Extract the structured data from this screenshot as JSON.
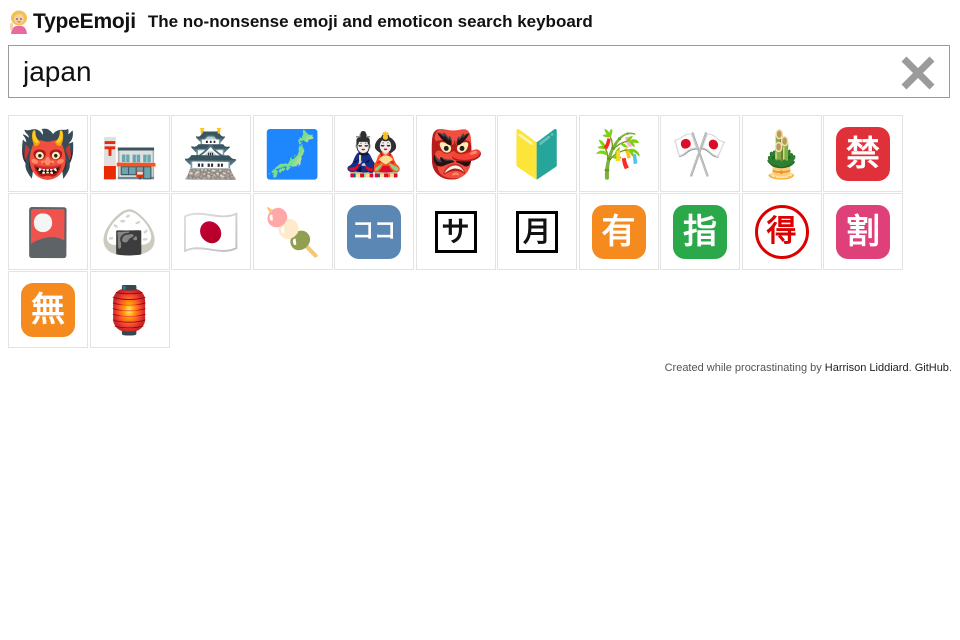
{
  "header": {
    "logo_icon": "person-raising-hand-emoji",
    "brand": "TypeEmoji",
    "tagline": "The no-nonsense emoji and emoticon search keyboard"
  },
  "search": {
    "value": "japan",
    "clear_icon": "close-x-icon"
  },
  "results": [
    {
      "name": "japanese-ogre",
      "glyph": "👹"
    },
    {
      "name": "japanese-post-office",
      "glyph": "🏣"
    },
    {
      "name": "japanese-castle",
      "glyph": "🏯"
    },
    {
      "name": "silhouette-of-japan",
      "glyph": "🗾"
    },
    {
      "name": "japanese-dolls",
      "glyph": "🎎"
    },
    {
      "name": "japanese-goblin",
      "glyph": "👺"
    },
    {
      "name": "japanese-symbol-for-beginner",
      "glyph": "🔰"
    },
    {
      "name": "tanabata-tree",
      "glyph": "🎋"
    },
    {
      "name": "crossed-flags",
      "glyph": "🎌"
    },
    {
      "name": "pine-decoration",
      "glyph": "🎍"
    },
    {
      "name": "prohibited-button",
      "glyph": "禁",
      "style": "tile",
      "color": "#e0303a"
    },
    {
      "name": "flower-playing-cards",
      "glyph": "🎴"
    },
    {
      "name": "rice-ball",
      "glyph": "🍙"
    },
    {
      "name": "flag-japan",
      "glyph": "🇯🇵"
    },
    {
      "name": "dango",
      "glyph": "🍡"
    },
    {
      "name": "here-button",
      "glyph": "ココ",
      "style": "tile",
      "color": "#5b87b5"
    },
    {
      "name": "service-charge-button",
      "glyph": "サ",
      "style": "box"
    },
    {
      "name": "monthly-amount-button",
      "glyph": "月",
      "style": "box"
    },
    {
      "name": "not-free-of-charge-button",
      "glyph": "有",
      "style": "tile",
      "color": "#f58a1f"
    },
    {
      "name": "reserved-button",
      "glyph": "指",
      "style": "tile",
      "color": "#2ba84a"
    },
    {
      "name": "bargain-button",
      "glyph": "得",
      "style": "circle"
    },
    {
      "name": "discount-button",
      "glyph": "割",
      "style": "tile",
      "color": "#e0407a"
    },
    {
      "name": "free-of-charge-button",
      "glyph": "無",
      "style": "tile",
      "color": "#f58a1f"
    },
    {
      "name": "red-paper-lantern",
      "glyph": "🏮"
    }
  ],
  "footer": {
    "prefix": "Created while procrastinating by ",
    "author": "Harrison Liddiard",
    "separator": ". ",
    "github": "GitHub",
    "suffix": "."
  }
}
